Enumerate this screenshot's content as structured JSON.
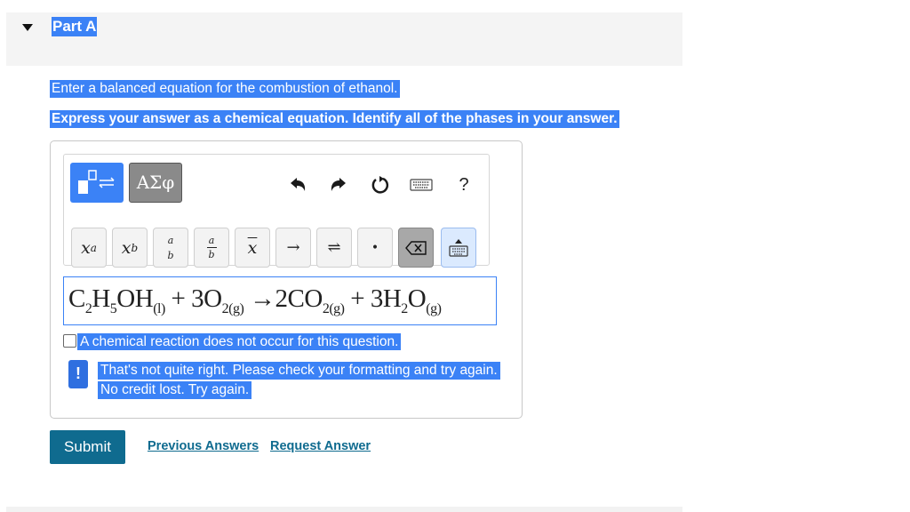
{
  "part": {
    "title": "Part A"
  },
  "question": {
    "prompt": "Enter a balanced equation for the combustion of ethanol.",
    "instruction": "Express your answer as a chemical equation. Identify all of the phases in your answer."
  },
  "toolbar": {
    "templates_icon": "templates-icon",
    "symbols_label": "ΑΣφ",
    "undo_icon": "undo-icon",
    "redo_icon": "redo-icon",
    "reset_icon": "reset-icon",
    "keyboard_icon": "keyboard-icon",
    "help_label": "?",
    "keys": {
      "superscript_base": "x",
      "superscript_exp": "a",
      "subscript_base": "x",
      "subscript_sub": "b",
      "fraction_num": "a",
      "fraction_den": "b",
      "ratio_num": "a",
      "ratio_den": "b",
      "mean": "x",
      "arrow": "→",
      "equilibrium": "⇌",
      "dot": "•",
      "delete_icon": "backspace-icon",
      "keyboard_toggle_icon": "keyboard-up-icon"
    }
  },
  "equation": {
    "parts": [
      "C",
      "2",
      "H",
      "5",
      "OH",
      "(l)",
      " + 3O",
      "2(g)",
      " →2CO",
      "2(g)",
      " + 3H",
      "2",
      "O",
      "(g)"
    ]
  },
  "no_reaction": {
    "checked": false,
    "label": "A chemical reaction does not occur for this question."
  },
  "feedback": {
    "line1": "That's not quite right. Please check your formatting and try again.",
    "line2": "No credit lost. Try again."
  },
  "actions": {
    "submit": "Submit",
    "previous_answers": "Previous Answers",
    "request_answer": "Request Answer"
  },
  "colors": {
    "selection": "#3b82f6",
    "submit_bg": "#0f6b8f",
    "link": "#0f6b8f",
    "alert": "#2f6fe0"
  }
}
